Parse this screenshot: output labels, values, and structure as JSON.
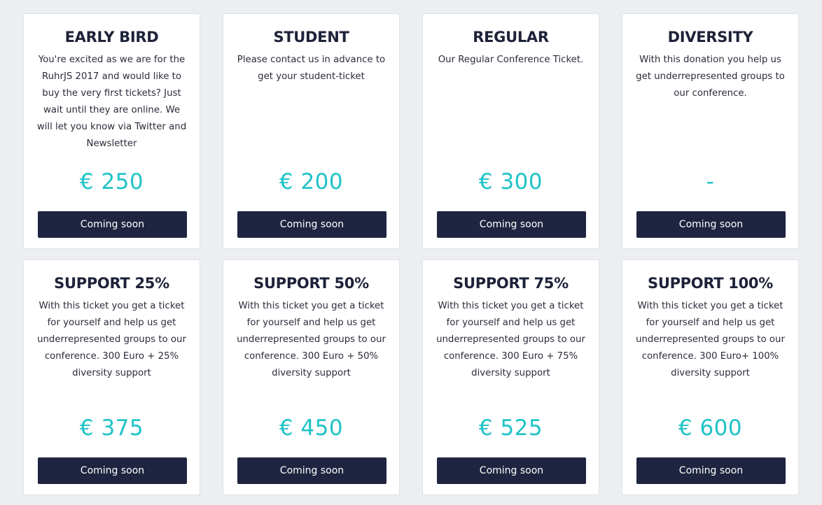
{
  "tickets": [
    {
      "title": "EARLY BIRD",
      "description": "You're excited as we are for the RuhrJS 2017 and would like to buy the very first tickets? Just wait until they are online. We will let you know via Twitter and Newsletter",
      "price": "€ 250",
      "button_label": "Coming soon"
    },
    {
      "title": "STUDENT",
      "description": "Please contact us in advance to get your student-ticket",
      "price": "€ 200",
      "button_label": "Coming soon"
    },
    {
      "title": "REGULAR",
      "description": "Our Regular Conference Ticket.",
      "price": "€ 300",
      "button_label": "Coming soon"
    },
    {
      "title": "DIVERSITY",
      "description": "With this donation you help us get underrepresented groups to our conference.",
      "price": "-",
      "button_label": "Coming soon"
    },
    {
      "title": "SUPPORT 25%",
      "description": "With this ticket you get a ticket for yourself and help us get underrepresented groups to our conference. 300 Euro + 25% diversity support",
      "price": "€ 375",
      "button_label": "Coming soon"
    },
    {
      "title": "SUPPORT 50%",
      "description": "With this ticket you get a ticket for yourself and help us get underrepresented groups to our conference. 300 Euro + 50% diversity support",
      "price": "€ 450",
      "button_label": "Coming soon"
    },
    {
      "title": "SUPPORT 75%",
      "description": "With this ticket you get a ticket for yourself and help us get underrepresented groups to our conference. 300 Euro + 75% diversity support",
      "price": "€ 525",
      "button_label": "Coming soon"
    },
    {
      "title": "SUPPORT 100%",
      "description": "With this ticket you get a ticket for yourself and help us get underrepresented groups to our conference. 300 Euro+ 100% diversity support",
      "price": "€ 600",
      "button_label": "Coming soon"
    }
  ],
  "colors": {
    "background": "#eceef1",
    "card": "#ffffff",
    "title": "#1e2238",
    "price_accent": "#1dc3c7",
    "button": "#1f2540",
    "button_text": "#ffffff"
  }
}
